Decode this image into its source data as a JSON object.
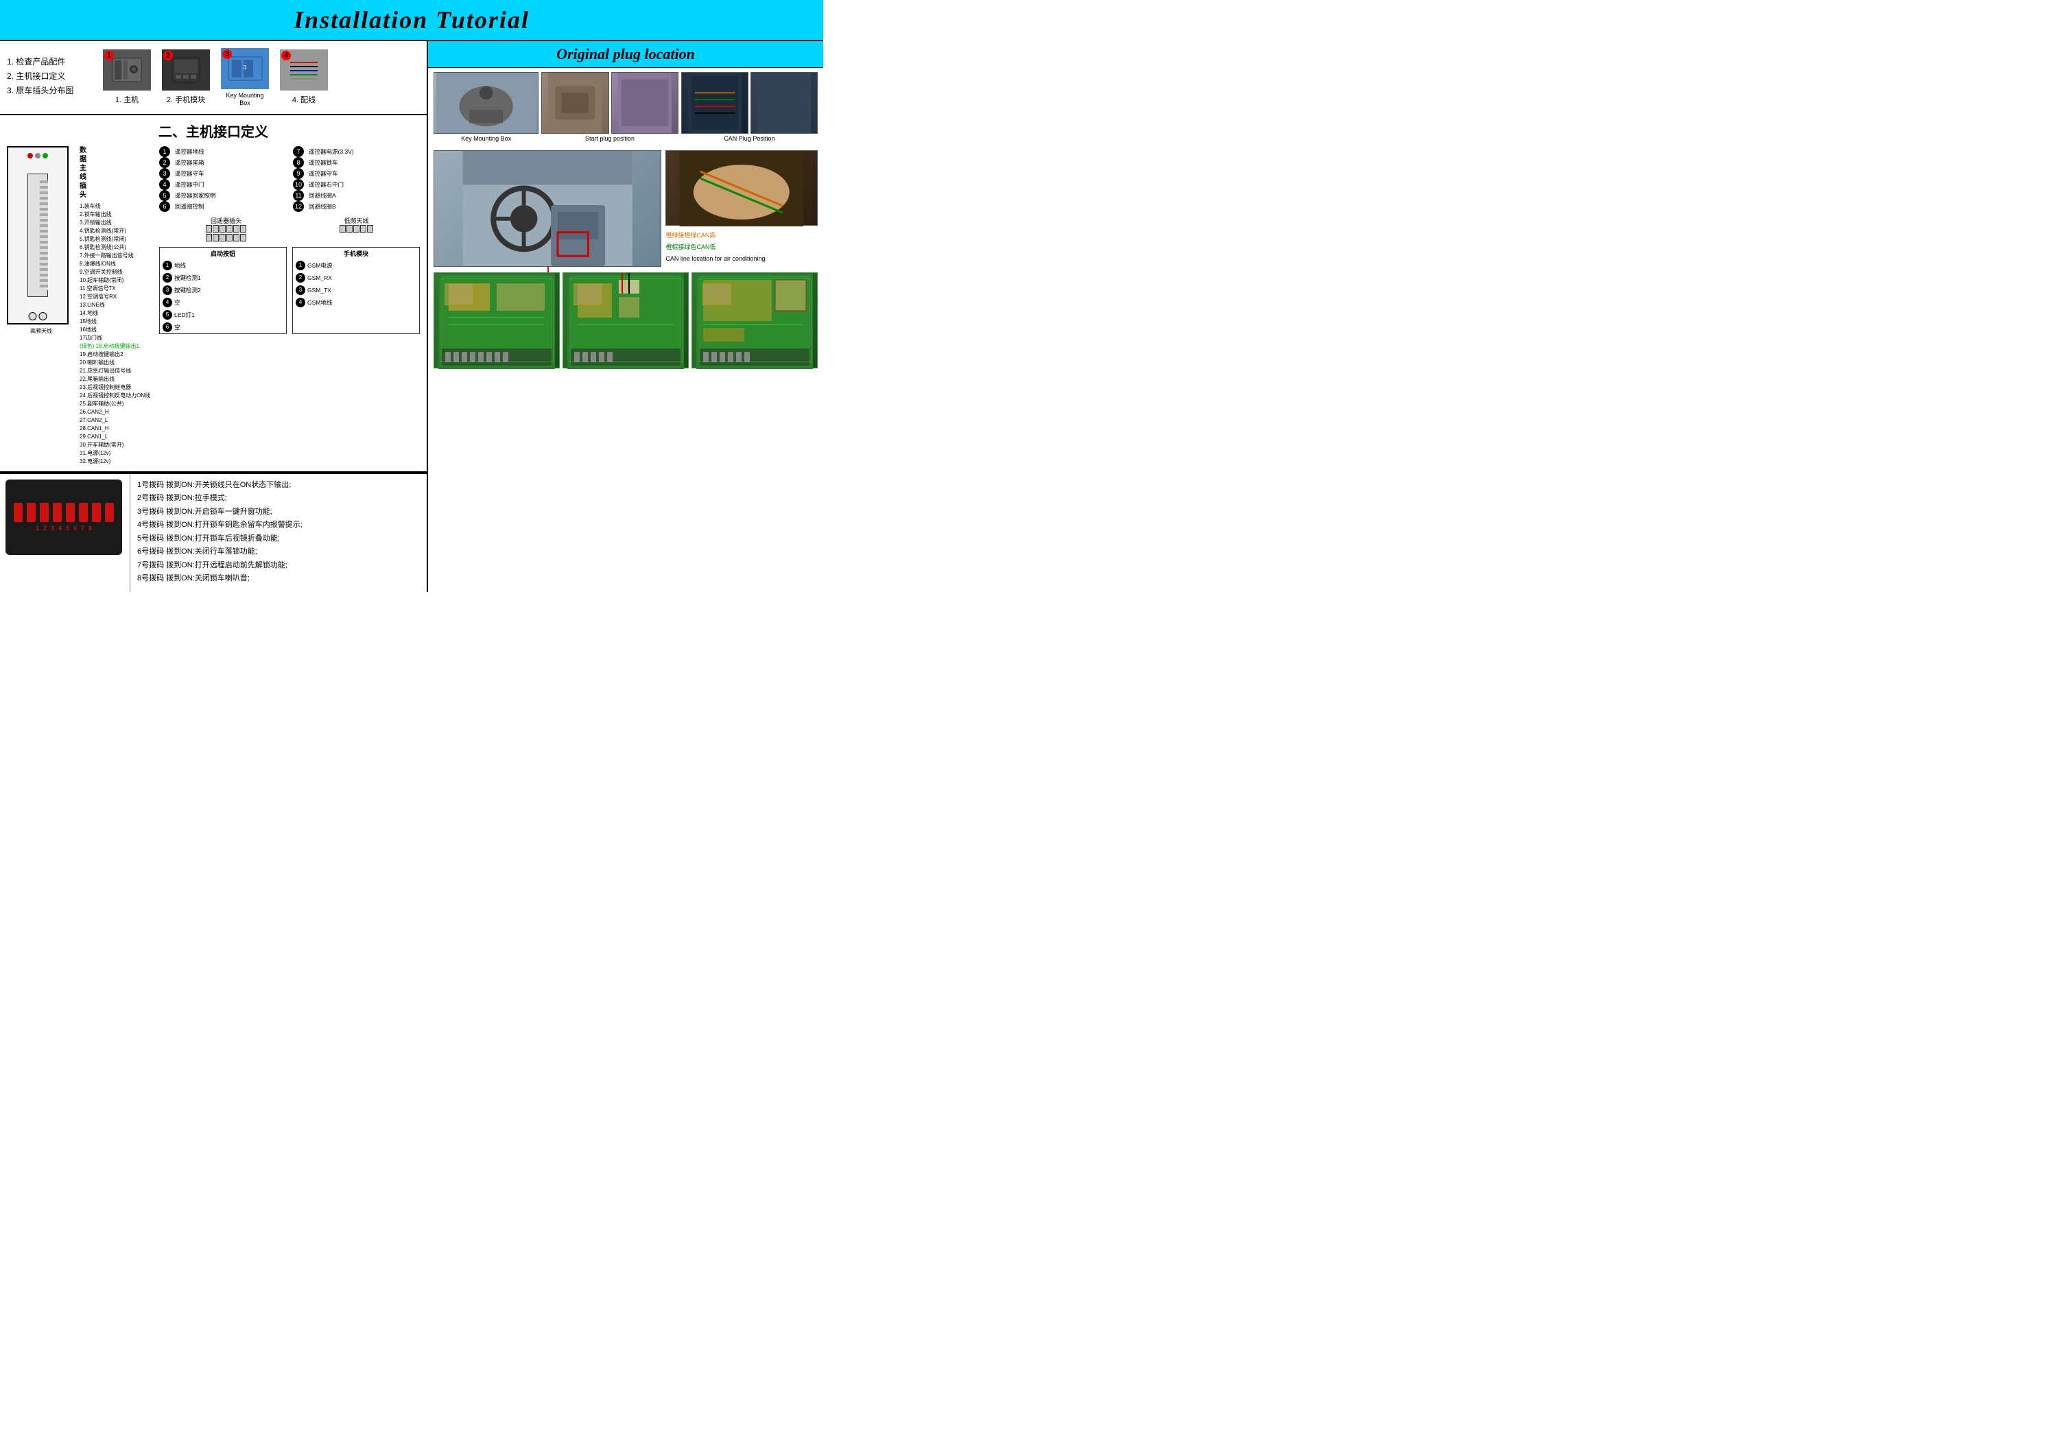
{
  "page": {
    "title": "Installation Tutorial",
    "right_title": "Original plug location",
    "bg_color": "#00d4ff"
  },
  "left_panel": {
    "checklist": {
      "items": [
        "1. 检查产品配件",
        "2. 主机接口定义",
        "3. 原车插头分布图"
      ]
    },
    "components": [
      {
        "id": "1",
        "label": "1. 主机",
        "color": "dark-gray"
      },
      {
        "id": "2",
        "label": "2. 手机模块",
        "color": "black"
      },
      {
        "id": "3",
        "label": "Key Mounting Box",
        "color": "blue"
      },
      {
        "id": "4",
        "label": "4. 配线",
        "color": "wires"
      }
    ],
    "interface_title": "二、主机接口定义",
    "wire_labels": [
      "1.装车线",
      "2.锁车输出线",
      "3.开锁输出线",
      "4.钥匙检测线(常开)",
      "5.钥匙检测线(常闭)",
      "6.钥匙检测线(公共)",
      "7.外接一路输出信号线",
      "8.油爆线/ON线",
      "9.空调开关控制线",
      "10.起车辅助(常闭)",
      "11.空调信号TX",
      "12.空调信号RX",
      "13.LINE线",
      "14.地线",
      "15地线",
      "16地线",
      "17边门线",
      "(绿色) 18.启动按键输出1",
      "19.启动按键输出2",
      "20.喇叭输出线",
      "21.应急灯输出信号线",
      "22.尾箱输出线",
      "23.后视镜控制继电器",
      "24.后视镜控制反电动力ON线",
      "25.副车辅助(公共)",
      "26.CAN2_H",
      "27.CAN2_L",
      "28.CAN1_H",
      "29.CAN1_L",
      "30.开车辅助(常开)",
      "31.电源(12v)",
      "32.电源(12v)"
    ],
    "connectors_left": [
      {
        "num": "1",
        "label": "遥控器地线"
      },
      {
        "num": "2",
        "label": "遥控器尾箱"
      },
      {
        "num": "3",
        "label": "遥控器守车"
      },
      {
        "num": "4",
        "label": "遥控器中门"
      },
      {
        "num": "5",
        "label": "遥控器回家照明"
      },
      {
        "num": "6",
        "label": "回遥圈控制"
      }
    ],
    "connectors_right": [
      {
        "num": "7",
        "label": "遥控器电源(3.3V)"
      },
      {
        "num": "8",
        "label": "遥控器锁车"
      },
      {
        "num": "9",
        "label": "遥控器守车"
      },
      {
        "num": "10",
        "label": "遥控器右中门"
      },
      {
        "num": "11",
        "label": "回避线圈A"
      },
      {
        "num": "12",
        "label": "回避线圈B"
      }
    ],
    "connector_labels": {
      "loop_plug": "回遥器插头",
      "low_freq": "低频天线"
    },
    "start_button_group": {
      "title": "启动按钮",
      "rows": [
        {
          "num": "1",
          "label": "地线"
        },
        {
          "num": "2",
          "label": "按键检测1"
        },
        {
          "num": "3",
          "label": "按键检测2"
        },
        {
          "num": "4",
          "label": "空"
        },
        {
          "num": "5",
          "label": "LED灯1"
        },
        {
          "num": "6",
          "label": "空"
        }
      ]
    },
    "phone_module_group": {
      "title": "手机模块",
      "rows": [
        {
          "num": "1",
          "label": "GSM电源"
        },
        {
          "num": "2",
          "label": "GSM_RX"
        },
        {
          "num": "3",
          "label": "GSM_TX"
        },
        {
          "num": "4",
          "label": "GSM地线"
        }
      ]
    },
    "dip_switches": {
      "numbers": [
        "1",
        "2",
        "3",
        "4",
        "5",
        "6",
        "7",
        "8"
      ]
    },
    "instructions": [
      "1号拨码 拨到ON:开关锁线只在ON状态下输出;",
      "2号拨码 拨到ON:拉手模式;",
      "3号拨码 拨到ON:开启锁车一键升窗功能;",
      "4号拨码 拨到ON:打开锁车钥匙余留车内报警提示;",
      "5号拨码 拨到ON:打开锁车后视镜折叠动能;",
      "6号拨码 拨到ON:关闭行车落锁功能;",
      "7号拨码 拨到ON:打开远程启动前先解锁功能;",
      "8号拨码 拨到ON:关闭锁车喇叭音;"
    ]
  },
  "right_panel": {
    "photo_labels": {
      "key_mounting_box": "Key Mounting Box",
      "start_plug": "Start plug position",
      "can_plug": "CAN Plug Position",
      "can_air_title": "CAN line location for air conditioning"
    },
    "can_lines": {
      "orange_high": "橙绿接橙绿CAN高",
      "orange_low": "橙棕接绿色CAN低"
    }
  }
}
